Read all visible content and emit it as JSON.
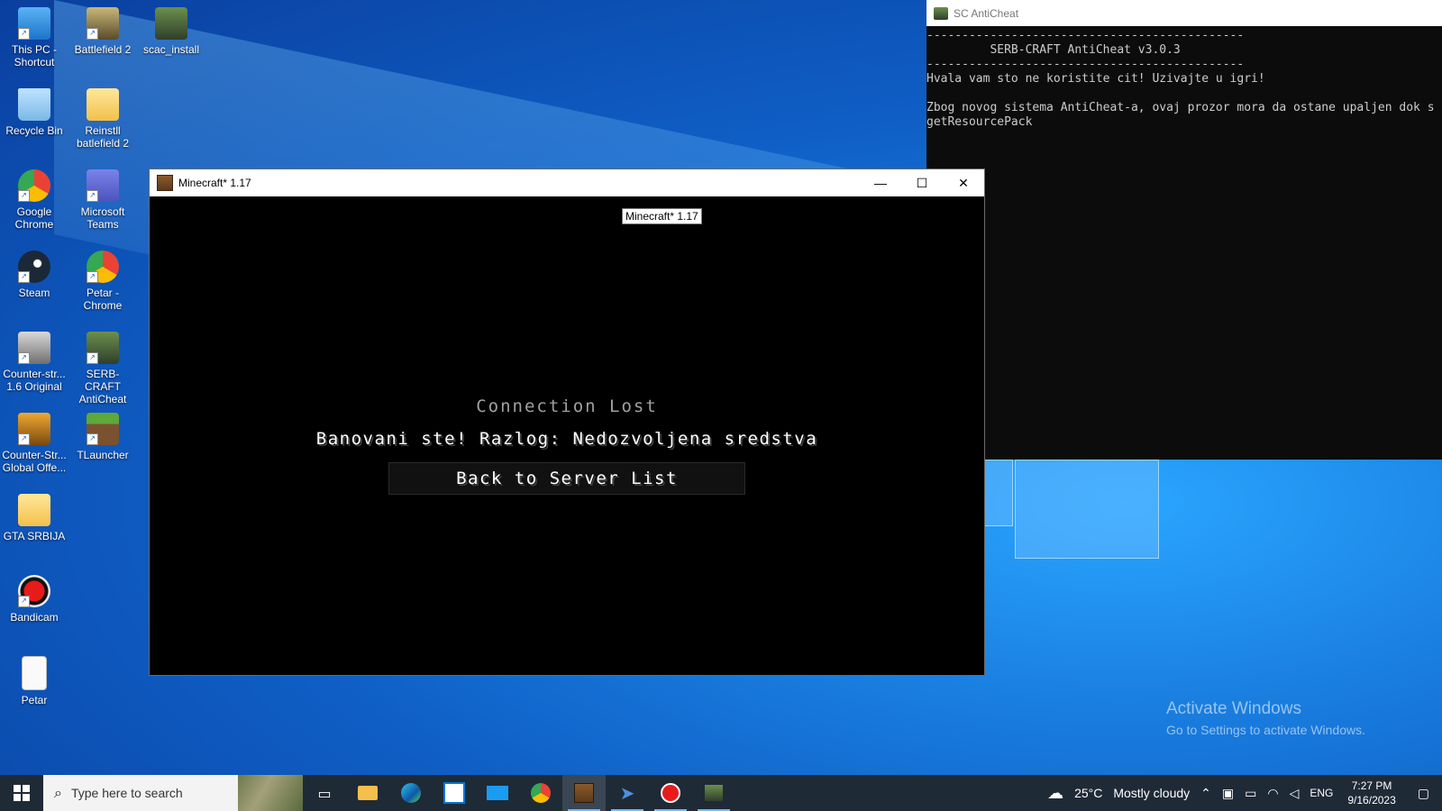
{
  "desktop": {
    "icons": [
      {
        "label": "This PC - Shortcut",
        "icon": "this-pc"
      },
      {
        "label": "Battlefield 2",
        "icon": "battlefield"
      },
      {
        "label": "scac_install",
        "icon": "scac"
      },
      {
        "label": "Recycle Bin",
        "icon": "recycle-bin"
      },
      {
        "label": "Reinstll batlefield 2",
        "icon": "folder"
      },
      {
        "label": "Google Chrome",
        "icon": "chrome"
      },
      {
        "label": "Microsoft Teams",
        "icon": "teams"
      },
      {
        "label": "Steam",
        "icon": "steam"
      },
      {
        "label": "Petar - Chrome",
        "icon": "chrome-profile"
      },
      {
        "label": "Counter-str... 1.6 Original",
        "icon": "counter-strike"
      },
      {
        "label": "SERB-CRAFT AntiCheat",
        "icon": "scac"
      },
      {
        "label": "Counter-Str... Global Offe...",
        "icon": "csgo"
      },
      {
        "label": "TLauncher",
        "icon": "tlauncher"
      },
      {
        "label": "GTA SRBIJA",
        "icon": "folder"
      },
      {
        "label": "Bandicam",
        "icon": "bandicam"
      },
      {
        "label": "Petar",
        "icon": "text-file"
      }
    ],
    "activate": {
      "line1": "Activate Windows",
      "line2": "Go to Settings to activate Windows."
    }
  },
  "console": {
    "title": "SC AntiCheat",
    "lines": [
      "---------------------------------------------",
      "         SERB-CRAFT AntiCheat v3.0.3",
      "---------------------------------------------",
      "Hvala vam sto ne koristite cit! Uzivajte u igri!",
      "",
      "Zbog novog sistema AntiCheat-a, ovaj prozor mora da ostane upaljen dok s",
      "getResourcePack"
    ]
  },
  "minecraft": {
    "title": "Minecraft* 1.17",
    "tooltip": "Minecraft* 1.17",
    "heading": "Connection Lost",
    "message": "Banovani ste! Razlog: Nedozvoljena sredstva",
    "button": "Back to Server List",
    "controls": {
      "minimize": "—",
      "maximize": "☐",
      "close": "✕"
    }
  },
  "taskbar": {
    "search_placeholder": "Type here to search",
    "apps": [
      "task-view",
      "file-explorer",
      "edge",
      "store",
      "mail",
      "chrome",
      "minecraft",
      "cursor-app",
      "bandicam",
      "scac"
    ],
    "weather": {
      "temp": "25°C",
      "desc": "Mostly cloudy"
    },
    "lang": "ENG",
    "time": "7:27 PM",
    "date": "9/16/2023"
  },
  "colors": {
    "accent": "#0078d7",
    "taskbar": "#1f2a37",
    "console_bg": "#0c0c0c"
  }
}
